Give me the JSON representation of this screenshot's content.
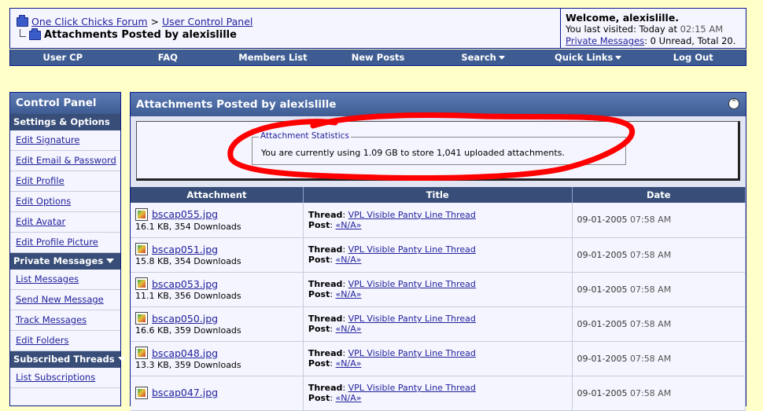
{
  "breadcrumb": {
    "forum": "One Click Chicks Forum",
    "separator": ">",
    "section": "User Control Panel",
    "page_title": "Attachments Posted by alexislille"
  },
  "welcome": {
    "title": "Welcome, alexislille.",
    "last_visit_label": "You last visited: Today at",
    "last_visit_time": "02:15 AM",
    "pm_link": "Private Messages",
    "pm_status": ": 0 Unread, Total 20."
  },
  "navbar": {
    "items": [
      "User CP",
      "FAQ",
      "Members List",
      "New Posts",
      "Search",
      "Quick Links",
      "Log Out"
    ]
  },
  "sidebar": {
    "title": "Control Panel",
    "sections": [
      {
        "label": "Settings & Options",
        "items": [
          "Edit Signature",
          "Edit Email & Password",
          "Edit Profile",
          "Edit Options",
          "Edit Avatar",
          "Edit Profile Picture"
        ]
      },
      {
        "label": "Private Messages",
        "items": [
          "List Messages",
          "Send New Message",
          "Track Messages",
          "Edit Folders"
        ]
      },
      {
        "label": "Subscribed Threads",
        "items": [
          "List Subscriptions"
        ]
      }
    ]
  },
  "main": {
    "title": "Attachments Posted by alexislille",
    "stats_legend": "Attachment Statistics",
    "stats_text": "You are currently using 1.09 GB to store 1,041 uploaded attachments.",
    "columns": [
      "Attachment",
      "Title",
      "Date"
    ],
    "thread_label": "Thread",
    "post_label": "Post",
    "rows": [
      {
        "file": "bscap055.jpg",
        "meta": "16.1 KB, 354 Downloads",
        "thread": "VPL Visible Panty Line Thread",
        "post": "«N/A»",
        "date": "09-01-2005",
        "time": "07:58 AM"
      },
      {
        "file": "bscap051.jpg",
        "meta": "15.8 KB, 354 Downloads",
        "thread": "VPL Visible Panty Line Thread",
        "post": "«N/A»",
        "date": "09-01-2005",
        "time": "07:58 AM"
      },
      {
        "file": "bscap053.jpg",
        "meta": "11.1 KB, 356 Downloads",
        "thread": "VPL Visible Panty Line Thread",
        "post": "«N/A»",
        "date": "09-01-2005",
        "time": "07:58 AM"
      },
      {
        "file": "bscap050.jpg",
        "meta": "16.6 KB, 359 Downloads",
        "thread": "VPL Visible Panty Line Thread",
        "post": "«N/A»",
        "date": "09-01-2005",
        "time": "07:58 AM"
      },
      {
        "file": "bscap048.jpg",
        "meta": "13.3 KB, 359 Downloads",
        "thread": "VPL Visible Panty Line Thread",
        "post": "«N/A»",
        "date": "09-01-2005",
        "time": "07:58 AM"
      },
      {
        "file": "bscap047.jpg",
        "meta": "",
        "thread": "VPL Visible Panty Line Thread",
        "post": "«N/A»",
        "date": "09-01-2005",
        "time": "07:58 AM"
      }
    ]
  },
  "colors": {
    "background": "#FFFFC8",
    "header_blue": "#3E5C92",
    "category_blue": "#384E78",
    "link": "#22229C",
    "annotation_red": "#FF0000"
  }
}
